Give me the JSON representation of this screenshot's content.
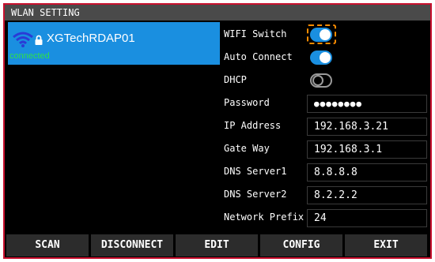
{
  "window": {
    "title": "WLAN SETTING"
  },
  "networks": [
    {
      "ssid": "XGTechRDAP01",
      "status": "connected",
      "signal_icon": "wifi-icon",
      "secured_icon": "lock-icon"
    }
  ],
  "settings": {
    "wifi_switch": {
      "label": "WIFI Switch",
      "state": "on"
    },
    "auto_connect": {
      "label": "Auto Connect",
      "state": "on"
    },
    "dhcp": {
      "label": "DHCP",
      "state": "off"
    },
    "password": {
      "label": "Password",
      "value": "●●●●●●●●"
    },
    "ip_address": {
      "label": "IP Address",
      "value": "192.168.3.21"
    },
    "gateway": {
      "label": "Gate Way",
      "value": "192.168.3.1"
    },
    "dns1": {
      "label": "DNS Server1",
      "value": "8.8.8.8"
    },
    "dns2": {
      "label": "DNS Server2",
      "value": "8.2.2.2"
    },
    "prefix": {
      "label": "Network Prefix",
      "value": "24"
    }
  },
  "buttons": {
    "scan": "SCAN",
    "disconnect": "DISCONNECT",
    "edit": "EDIT",
    "config": "CONFIG",
    "exit": "EXIT"
  },
  "colors": {
    "accent": "#1a8fe0",
    "connected": "#2ee04a",
    "focus": "#ff8c00",
    "frame_border": "#c8102e",
    "titlebar": "#4a4a4a"
  }
}
